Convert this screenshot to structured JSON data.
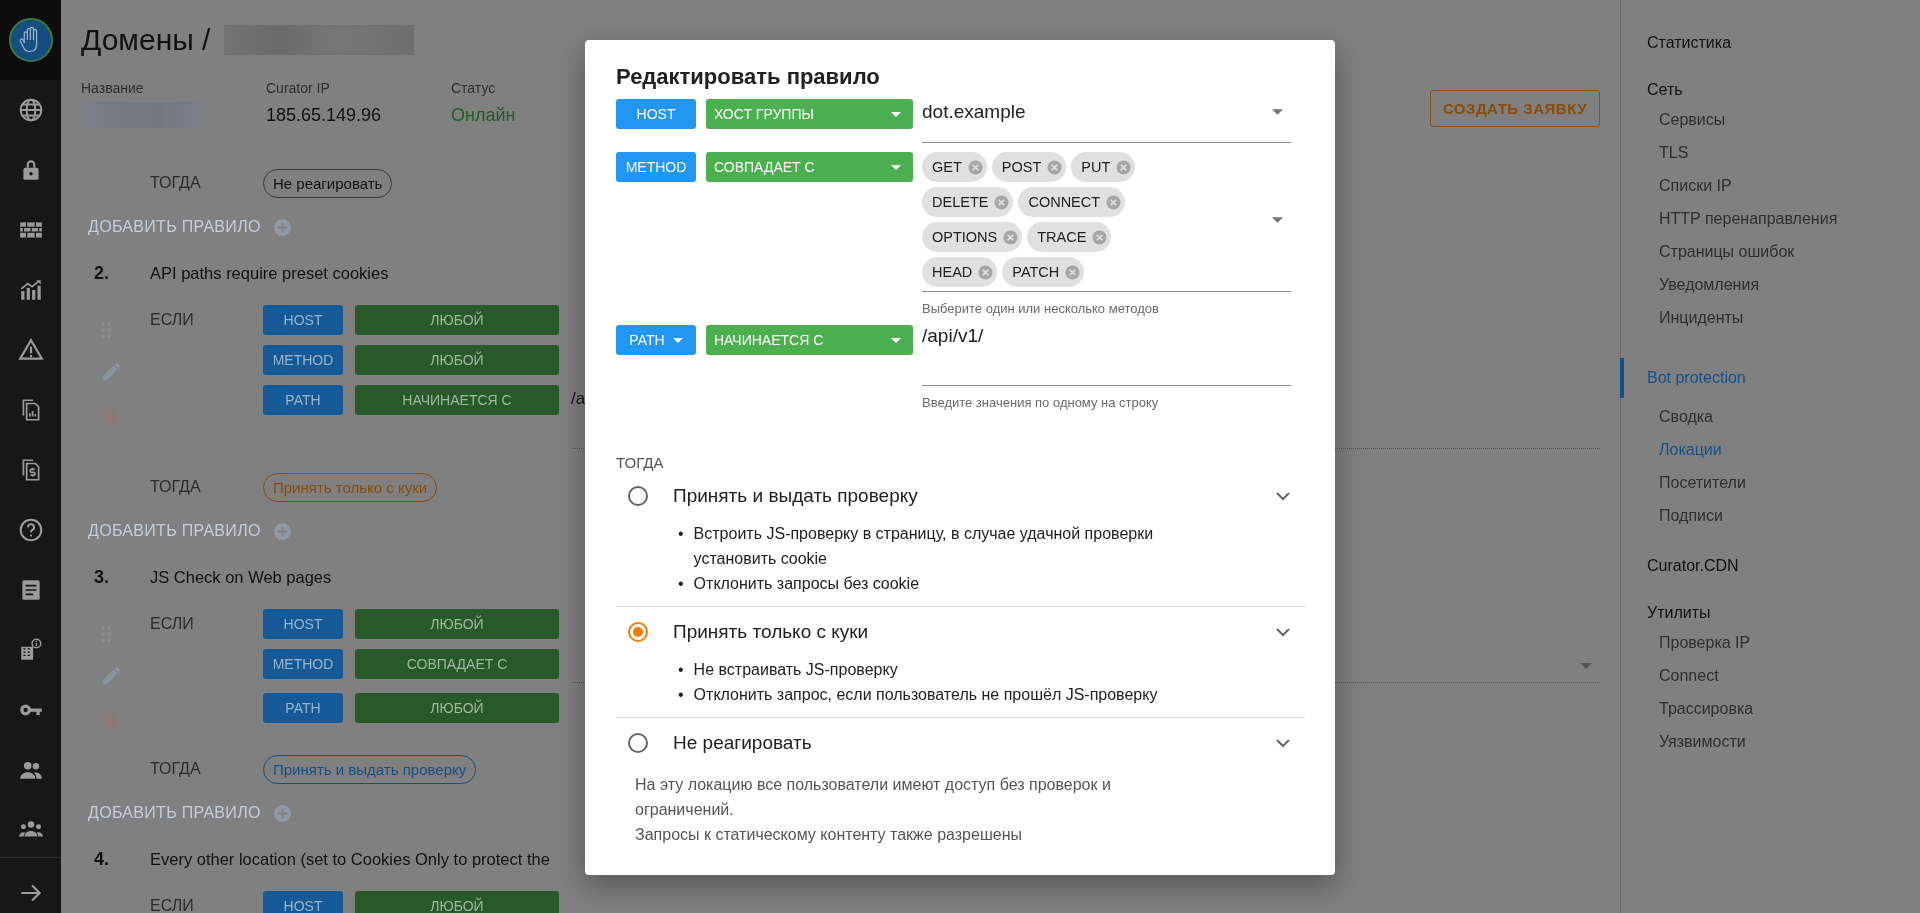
{
  "page": {
    "title": "Домены /",
    "info": [
      {
        "label": "Название",
        "kind": "redacted"
      },
      {
        "label": "Curator IP",
        "value": "185.65.149.96",
        "kind": "plain"
      },
      {
        "label": "Статус",
        "value": "Онлайн",
        "kind": "status"
      }
    ],
    "create_button": "СОЗДАТЬ ЗАЯВКУ"
  },
  "rules": [
    {
      "then_label": "ТОГДА",
      "action": {
        "label": "Не реагировать",
        "kind": "none"
      },
      "add_label": "ДОБАВИТЬ ПРАВИЛО"
    },
    {
      "number": "2.",
      "title": "API paths require preset cookies",
      "if_label": "ЕСЛИ",
      "conditions": [
        {
          "field": "HOST",
          "op": "ЛЮБОЙ",
          "kind": "plain"
        },
        {
          "field": "METHOD",
          "op": "ЛЮБОЙ",
          "kind": "plain"
        },
        {
          "field": "PATH",
          "op": "НАЧИНАЕТСЯ С",
          "kind": "text",
          "value": "/a"
        }
      ],
      "then_label": "ТОГДА",
      "action": {
        "label": "Принять только с куки",
        "kind": "cookies"
      },
      "add_label": "ДОБАВИТЬ ПРАВИЛО"
    },
    {
      "number": "3.",
      "title": "JS Check on Web pages",
      "if_label": "ЕСЛИ",
      "conditions": [
        {
          "field": "HOST",
          "op": "ЛЮБОЙ",
          "kind": "plain"
        },
        {
          "field": "METHOD",
          "op": "СОВПАДАЕТ С",
          "kind": "select"
        },
        {
          "field": "PATH",
          "op": "ЛЮБОЙ",
          "kind": "plain"
        }
      ],
      "then_label": "ТОГДА",
      "action": {
        "label": "Принять и выдать проверку",
        "kind": "challenge"
      },
      "add_label": "ДОБАВИТЬ ПРАВИЛО"
    },
    {
      "number": "4.",
      "title": "Every other location (set to Cookies Only to protect the",
      "if_label": "ЕСЛИ",
      "conditions": [
        {
          "field": "HOST",
          "op": "ЛЮБОЙ",
          "kind": "plain"
        }
      ]
    }
  ],
  "dialog": {
    "title": "Редактировать правило",
    "conditions": [
      {
        "field": "HOST",
        "field_dropdown": false,
        "op": "ХОСТ ГРУППЫ",
        "kind": "select",
        "value": "dot.example"
      },
      {
        "field": "METHOD",
        "field_dropdown": false,
        "op": "СОВПАДАЕТ С",
        "kind": "chips",
        "chips": [
          [
            "GET",
            "POST",
            "PUT"
          ],
          [
            "DELETE",
            "CONNECT"
          ],
          [
            "OPTIONS",
            "TRACE"
          ],
          [
            "HEAD",
            "PATCH"
          ]
        ],
        "helper": "Выберите один или несколько методов"
      },
      {
        "field": "PATH",
        "field_dropdown": true,
        "op": "НАЧИНАЕТСЯ С",
        "kind": "text",
        "value": "/api/v1/",
        "helper": "Введите значения по одному на строку"
      }
    ],
    "then_label": "ТОГДА",
    "bullet_marker": "•",
    "options": [
      {
        "label": "Принять и выдать проверку",
        "selected": false,
        "bullets": [
          "Встроить JS-проверку в страницу, в случае удачной проверки установить cookie",
          "Отклонить запросы без cookie"
        ]
      },
      {
        "label": "Принять только с куки",
        "selected": true,
        "bullets": [
          "Не встраивать JS-проверку",
          "Отклонить запрос, если пользователь не прошёл JS-проверку"
        ]
      },
      {
        "label": "Не реагировать",
        "selected": false,
        "description": [
          "На эту локацию все пользователи имеют доступ без проверок и ограничений.",
          "Запросы к статическому контенту также разрешены"
        ]
      }
    ]
  },
  "side_nav": [
    {
      "label": "Статистика",
      "selected": false
    },
    {
      "label": "Сеть",
      "selected": false,
      "children": [
        {
          "label": "Сервисы",
          "selected": false
        },
        {
          "label": "TLS",
          "selected": false
        },
        {
          "label": "Списки IP",
          "selected": false
        },
        {
          "label": "HTTP перенаправления",
          "selected": false
        },
        {
          "label": "Страницы ошибок",
          "selected": false
        },
        {
          "label": "Уведомления",
          "selected": false
        },
        {
          "label": "Инциденты",
          "selected": false
        }
      ]
    },
    {
      "label": "Bot protection",
      "selected": true,
      "children": [
        {
          "label": "Сводка",
          "selected": false
        },
        {
          "label": "Локации",
          "selected": true
        },
        {
          "label": "Посетители",
          "selected": false
        },
        {
          "label": "Подписи",
          "selected": false
        }
      ]
    },
    {
      "label": "Curator.CDN",
      "selected": false
    },
    {
      "label": "Утилиты",
      "selected": false,
      "children": [
        {
          "label": "Проверка IP",
          "selected": false
        },
        {
          "label": "Connect",
          "selected": false
        },
        {
          "label": "Трассировка",
          "selected": false
        },
        {
          "label": "Уязвимости",
          "selected": false
        }
      ]
    }
  ]
}
